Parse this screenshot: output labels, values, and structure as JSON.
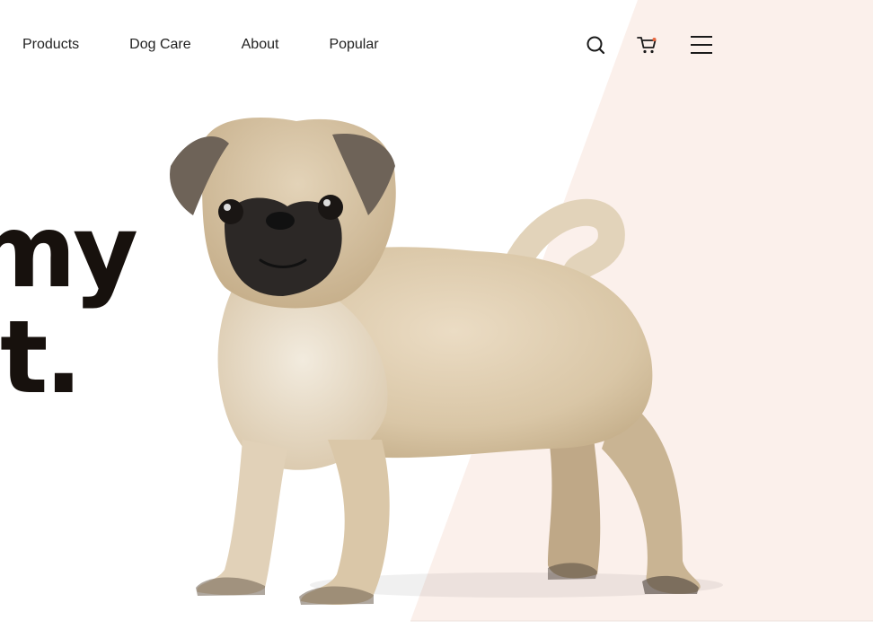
{
  "nav": {
    "items": [
      {
        "label": "Products"
      },
      {
        "label": "Dog Care"
      },
      {
        "label": "About"
      },
      {
        "label": "Popular"
      }
    ]
  },
  "header_icons": {
    "search": "search-icon",
    "cart": "cart-icon",
    "menu": "hamburger-menu-icon",
    "cart_dot_color": "#e8663d"
  },
  "hero": {
    "line1": "my",
    "line2": "t."
  },
  "colors": {
    "accent_panel": "#fbf0eb",
    "heading": "#17110d"
  }
}
